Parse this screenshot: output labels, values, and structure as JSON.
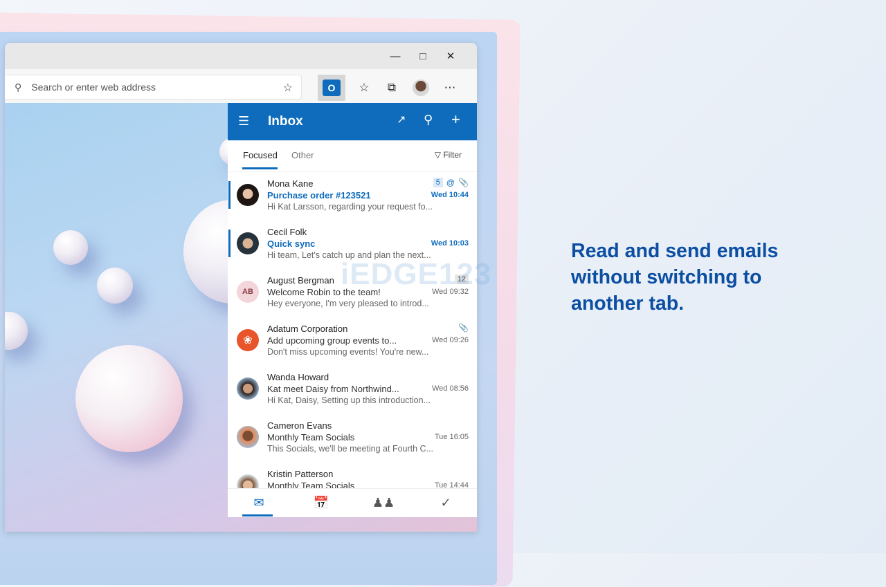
{
  "browser": {
    "address_placeholder": "Search or enter web address",
    "window_controls": [
      "minimize-icon",
      "maximize-icon",
      "close-icon"
    ]
  },
  "outlook": {
    "header": {
      "title": "Inbox"
    },
    "tabs": [
      {
        "label": "Focused",
        "active": true
      },
      {
        "label": "Other",
        "active": false
      }
    ],
    "filter_label": "Filter",
    "emails": [
      {
        "from": "Mona Kane",
        "subject": "Purchase order #123521",
        "preview": "Hi Kat Larsson, regarding your request fo...",
        "time": "Wed 10:44",
        "unread": true,
        "count": "5",
        "mention": "@",
        "attachment": true
      },
      {
        "from": "Cecil Folk",
        "subject": "Quick sync",
        "preview": "Hi team, Let's catch up and plan the next...",
        "time": "Wed 10:03",
        "unread": true
      },
      {
        "from": "August Bergman",
        "initials": "AB",
        "subject": "Welcome Robin to the team!",
        "preview": "Hey everyone, I'm very pleased to introd...",
        "time": "Wed 09:32",
        "count": "12"
      },
      {
        "from": "Adatum Corporation",
        "subject": "Add upcoming group events to...",
        "preview": "Don't miss upcoming events! You're new...",
        "time": "Wed 09:26",
        "attachment": true
      },
      {
        "from": "Wanda Howard",
        "subject": "Kat meet Daisy from Northwind...",
        "preview": "Hi Kat, Daisy, Setting up this introduction...",
        "time": "Wed 08:56"
      },
      {
        "from": "Cameron Evans",
        "subject": "Monthly Team Socials",
        "preview": "This Socials, we'll be meeting at Fourth C...",
        "time": "Tue 16:05"
      },
      {
        "from": "Kristin Patterson",
        "subject": "Monthly Team Socials",
        "preview": "",
        "time": "Tue 14:44"
      }
    ],
    "nav": [
      "mail-icon",
      "calendar-icon",
      "people-icon",
      "todo-icon"
    ],
    "accent": "#0f6cbd"
  },
  "tagline": "Read and send emails without switching to another tab.",
  "watermark": "iEDGE123"
}
